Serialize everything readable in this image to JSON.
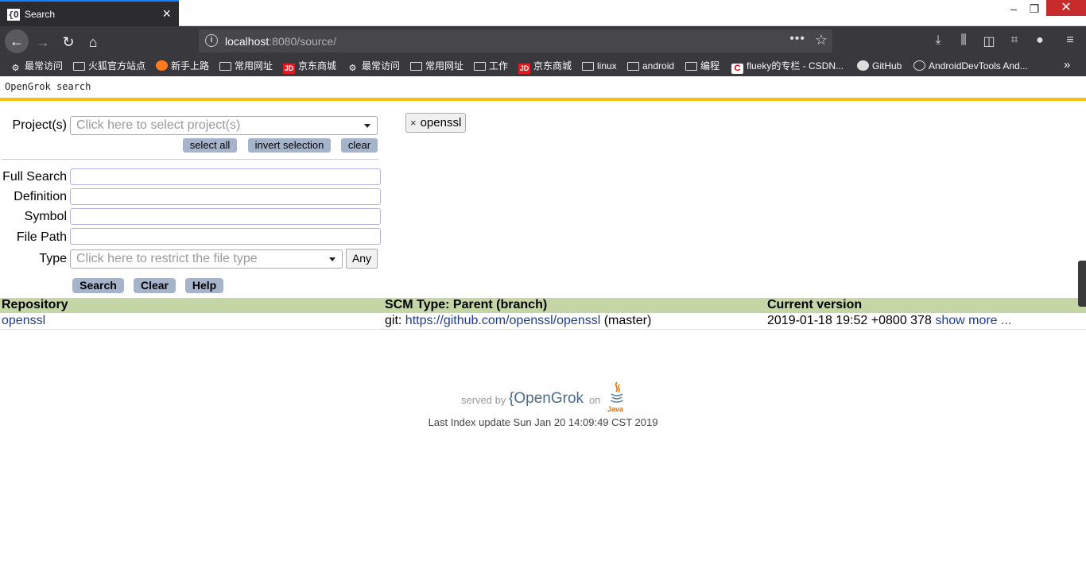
{
  "browser": {
    "tab_title": "Search",
    "tab_favicon": "{O",
    "url_host": "localhost",
    "url_rest": ":8080/source/",
    "window_controls": {
      "minimize": "–",
      "restore": "❐",
      "close": "✕"
    }
  },
  "bookmarks": [
    {
      "label": "最常访问",
      "icon": "gear-icon"
    },
    {
      "label": "火狐官方站点",
      "icon": "folder-icon"
    },
    {
      "label": "新手上路",
      "icon": "firefox-icon"
    },
    {
      "label": "常用网址",
      "icon": "folder-icon"
    },
    {
      "label": "京东商城",
      "icon": "jd-icon"
    },
    {
      "label": "最常访问",
      "icon": "gear-icon"
    },
    {
      "label": "常用网址",
      "icon": "folder-icon"
    },
    {
      "label": "工作",
      "icon": "folder-icon"
    },
    {
      "label": "京东商城",
      "icon": "jd-icon"
    },
    {
      "label": "linux",
      "icon": "folder-icon"
    },
    {
      "label": "android",
      "icon": "folder-icon"
    },
    {
      "label": "编程",
      "icon": "folder-icon"
    },
    {
      "label": "flueky的专栏 - CSDN...",
      "icon": "csdn-icon"
    },
    {
      "label": "GitHub",
      "icon": "github-icon"
    },
    {
      "label": "AndroidDevTools And...",
      "icon": "globe-icon"
    }
  ],
  "page": {
    "header_title": "OpenGrok search",
    "projects_label": "Project(s)",
    "projects_placeholder": "Click here to select project(s)",
    "select_all": "select all",
    "invert_selection": "invert selection",
    "clear_small": "clear",
    "selected_project": "openssl",
    "full_search_label": "Full Search",
    "definition_label": "Definition",
    "symbol_label": "Symbol",
    "file_path_label": "File Path",
    "type_label": "Type",
    "type_placeholder": "Click here to restrict the file type",
    "any_button": "Any",
    "search_button": "Search",
    "clear_button": "Clear",
    "help_button": "Help"
  },
  "repo_table": {
    "headers": [
      "Repository",
      "SCM Type: Parent (branch)",
      "Current version"
    ],
    "rows": [
      {
        "repository": "openssl",
        "scm_prefix": "git: ",
        "scm_url": "https://github.com/openssl/openssl",
        "scm_branch": " (master)",
        "version": "2019-01-18 19:52 +0800 378",
        "show_more": "show more ..."
      }
    ]
  },
  "footer": {
    "served_by": "served by",
    "brand_open": "{",
    "brand_name": "OpenGrok",
    "on": "on",
    "java": "Java",
    "last_index": "Last Index update Sun Jan 20 14:09:49 CST 2019"
  }
}
